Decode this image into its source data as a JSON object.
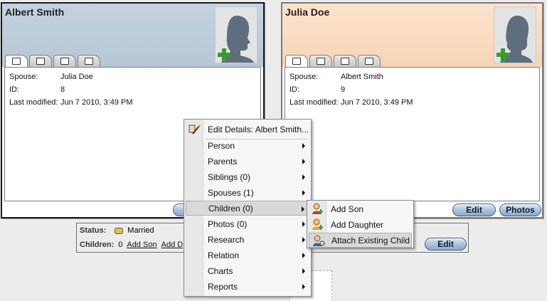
{
  "cards": {
    "left": {
      "name": "Albert Smith",
      "fields": [
        {
          "label": "Spouse:",
          "value": "Julia Doe"
        },
        {
          "label": "ID:",
          "value": "8"
        },
        {
          "label": "Last modified:",
          "value": "Jun 7 2010, 3:49 PM"
        }
      ]
    },
    "right": {
      "name": "Julia Doe",
      "fields": [
        {
          "label": "Spouse:",
          "value": "Albert Smith"
        },
        {
          "label": "ID:",
          "value": "9"
        },
        {
          "label": "Last modified:",
          "value": "Jun 7 2010, 3:49 PM"
        }
      ],
      "edit_label": "Edit",
      "photos_label": "Photos"
    }
  },
  "family": {
    "status_label": "Status:",
    "status_value": "Married",
    "children_label": "Children:",
    "children_count": "0",
    "add_son": "Add Son",
    "add_daughter_partial": "Add D",
    "edit_label": "Edit"
  },
  "context_menu": {
    "items": [
      {
        "label": "Edit Details: Albert Smith...",
        "submenu": false
      },
      {
        "label": "Person",
        "submenu": true
      },
      {
        "label": "Parents",
        "submenu": true
      },
      {
        "label": "Siblings (0)",
        "submenu": true
      },
      {
        "label": "Spouses (1)",
        "submenu": true
      },
      {
        "label": "Children (0)",
        "submenu": true,
        "highlighted": true
      },
      {
        "label": "Photos (0)",
        "submenu": true
      },
      {
        "label": "Research",
        "submenu": true
      },
      {
        "label": "Relation",
        "submenu": true
      },
      {
        "label": "Charts",
        "submenu": true
      },
      {
        "label": "Reports",
        "submenu": true
      }
    ]
  },
  "children_submenu": {
    "items": [
      {
        "label": "Add Son",
        "icon": "add-son-icon"
      },
      {
        "label": "Add Daughter",
        "icon": "add-daughter-icon"
      },
      {
        "label": "Attach Existing Child",
        "icon": "attach-child-icon",
        "highlighted": true
      }
    ]
  },
  "colors": {
    "male_header": "#c4d2e0",
    "female_header": "#fce3cc",
    "button_border": "#3f5d80"
  }
}
